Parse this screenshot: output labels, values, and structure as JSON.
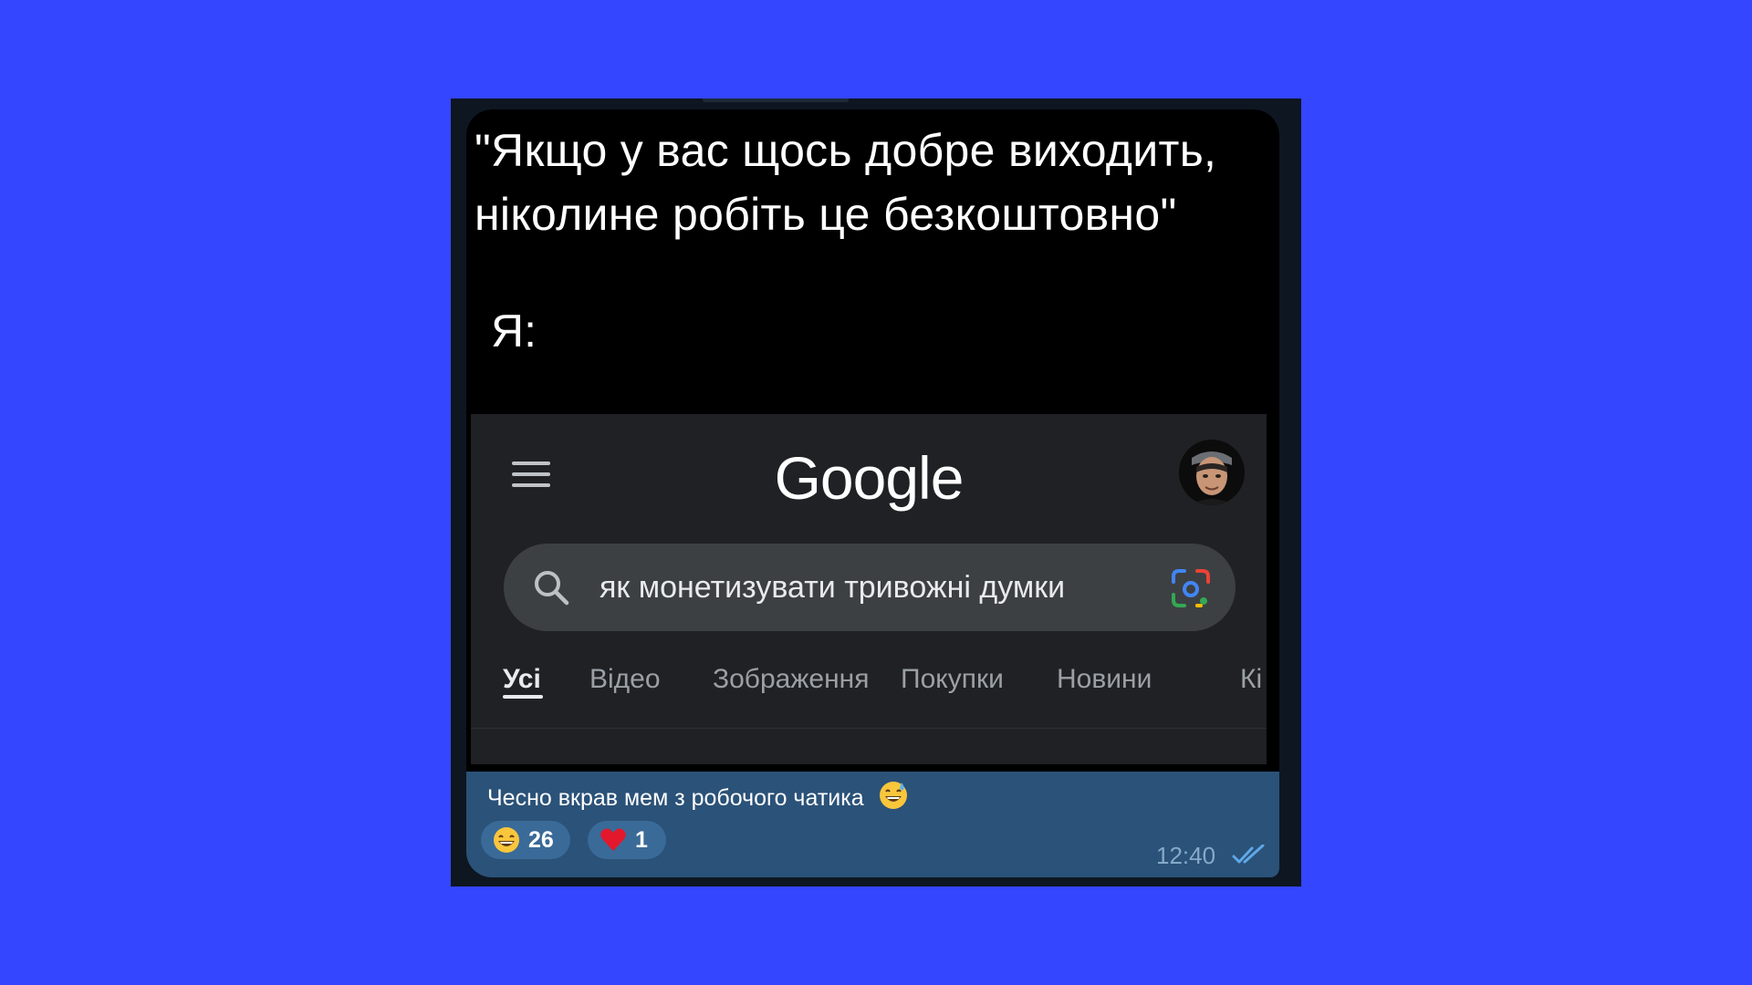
{
  "colors": {
    "background": "#3446ff",
    "window": "#0e1621",
    "bubble": "#2b5278",
    "google_panel": "#202124",
    "search_bar": "#3c4043"
  },
  "meme": {
    "quote_line1": "\"Якщо у вас щось добре виходить,",
    "quote_line2": "ніколине робіть це безкоштовно\"",
    "me_label": "Я:"
  },
  "google": {
    "logo_text": "Google",
    "menu_icon": "hamburger-menu-icon",
    "avatar": "profile-avatar",
    "search_query": "як монетизувати тривожні думки",
    "search_icon": "search-icon",
    "lens_icon": "google-lens-icon",
    "tabs": [
      {
        "label": "Усі",
        "active": true
      },
      {
        "label": "Відео",
        "active": false
      },
      {
        "label": "Зображення",
        "active": false
      },
      {
        "label": "Покупки",
        "active": false
      },
      {
        "label": "Новини",
        "active": false
      },
      {
        "label": "Кі",
        "active": false
      }
    ]
  },
  "message": {
    "caption": "Чесно вкрав мем з робочого чатика",
    "caption_emoji": "sweat-smile-emoji",
    "reactions": [
      {
        "emoji": "grinning-face-emoji",
        "count": "26"
      },
      {
        "emoji": "red-heart-emoji",
        "count": "1"
      }
    ],
    "time": "12:40",
    "status_icon": "double-check-icon"
  }
}
